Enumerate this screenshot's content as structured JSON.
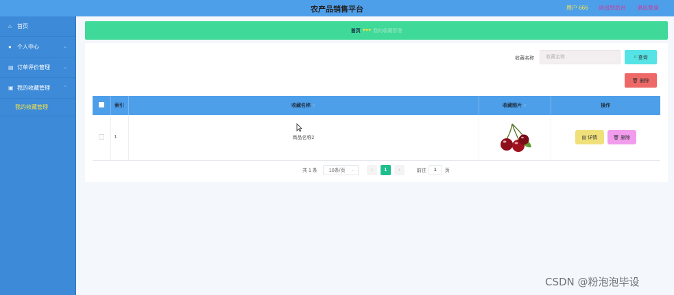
{
  "topbar": {
    "title": "农产品销售平台",
    "user": "用户 666",
    "backend": "退出到后台",
    "logout": "退出登录"
  },
  "sidebar": {
    "items": [
      {
        "label": "首页",
        "icon": "home-icon"
      },
      {
        "label": "个人中心",
        "icon": "user-icon"
      },
      {
        "label": "订单评价管理",
        "icon": "document-icon"
      },
      {
        "label": "我的收藏管理",
        "icon": "folder-icon"
      }
    ],
    "sub_item": "我的收藏管理"
  },
  "breadcrumb": {
    "home": "首页",
    "separator": "♥♥♥",
    "current": "我的收藏管理"
  },
  "search": {
    "label": "收藏名称",
    "placeholder": "收藏名称",
    "query_label": "查询",
    "delete_label": "删除"
  },
  "table": {
    "headers": [
      "索引",
      "收藏名称",
      "收藏图片",
      "操作"
    ],
    "rows": [
      {
        "index": "1",
        "name": "商品名称2",
        "image": "cherry-image",
        "detail_label": "详情",
        "delete_label": "删除"
      }
    ]
  },
  "pagination": {
    "total": "共 1 条",
    "page_size": "10条/页",
    "current_page": "1",
    "goto_label": "前往",
    "goto_value": "1",
    "page_suffix": "页"
  },
  "watermark": "CSDN @粉泡泡毕设",
  "colors": {
    "topbar": "#4e9fea",
    "sidebar": "#3c8ad8",
    "breadcrumb": "#3fd99a",
    "query_button": "#55e3e6",
    "delete_button": "#ee6868",
    "detail_button": "#f0e07a",
    "row_delete_button": "#f19cec",
    "active_page": "#1ebf8c"
  }
}
